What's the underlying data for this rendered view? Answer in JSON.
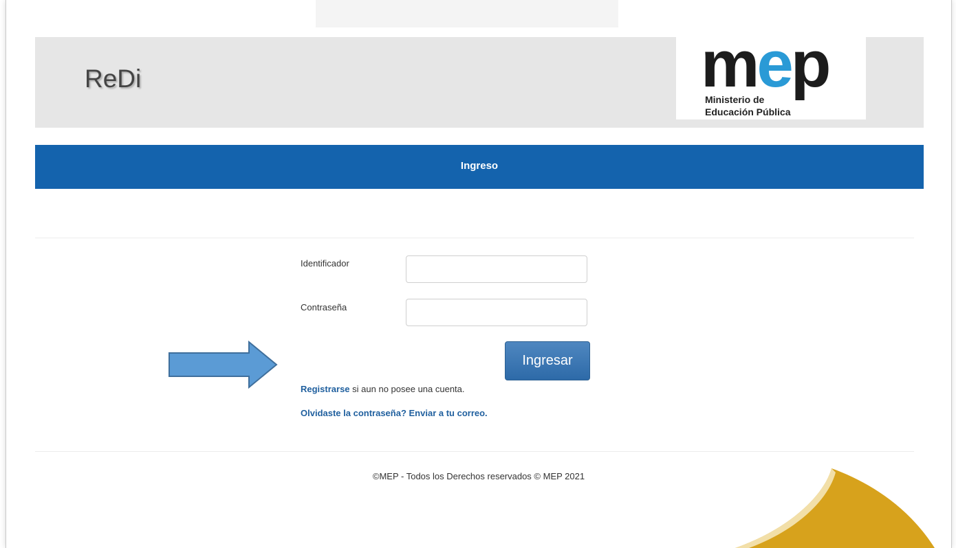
{
  "header": {
    "app_title": "ReDi",
    "logo": {
      "mark": "mep",
      "line1": "Ministerio de",
      "line2": "Educación Pública"
    }
  },
  "nav": {
    "title": "Ingreso"
  },
  "form": {
    "id_label": "Identificador",
    "id_value": "",
    "password_label": "Contraseña",
    "password_value": "",
    "submit_label": "Ingresar",
    "register_link": "Registrarse",
    "register_rest": " si aun no posee una cuenta.",
    "forgot_link": "Olvidaste la contraseña? Enviar a tu correo."
  },
  "footer": {
    "text": "©MEP - Todos los Derechos reservados © MEP 2021"
  },
  "colors": {
    "navbar": "#1463ad",
    "button": "#2d6aa8",
    "link": "#1f5f9e",
    "annotation_arrow": "#5b9bd5",
    "page_curl": "#d7a21c"
  },
  "icons": [
    "annotation-arrow-icon",
    "page-curl-decoration"
  ]
}
